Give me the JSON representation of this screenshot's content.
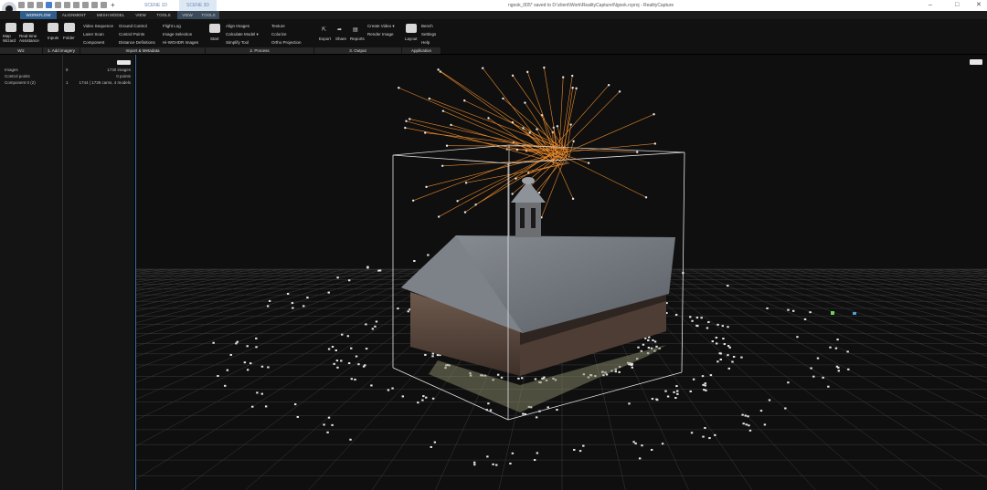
{
  "titlebar": {
    "scene_tabs": [
      "SCENE 1D",
      "SCENE 3D"
    ],
    "window_title": "ngook_005* saved to D:\\client\\Work\\RealityCapture\\Ngook.rcproj - RealityCapture",
    "minimize": "–",
    "maximize": "□",
    "close": "✕"
  },
  "tabs": [
    "WORKFLOW",
    "ALIGNMENT",
    "MESH MODEL",
    "VIEW",
    "TOOLS",
    "VIEW",
    "TOOLS"
  ],
  "ribbon": {
    "groups": [
      {
        "label": "Wiz"
      },
      {
        "label": "1. Add imagery"
      },
      {
        "label": "Import & Metadata"
      },
      {
        "label": "2. Process"
      },
      {
        "label": "3. Output"
      },
      {
        "label": "Application"
      }
    ],
    "wiz": [
      "Map Wizard",
      "Real-time Assistance"
    ],
    "add_imagery": [
      "Inputs",
      "Folder"
    ],
    "import_col1": [
      "Video Sequence",
      "Laser Scan",
      "Component"
    ],
    "import_col2": [
      "Ground Control",
      "Control Points",
      "Distance Definitions"
    ],
    "import_col3": [
      "Flight Log",
      "Image Selection",
      "Hi-WGHDR Images"
    ],
    "process_start": "Start",
    "process_col1": [
      "Align Images",
      "Calculate Model ▾",
      "Simplify Tool"
    ],
    "process_col2": [
      "Texture",
      "Colorize",
      "Ortho Projection"
    ],
    "output_btns": [
      "Export",
      "Share",
      "Reports"
    ],
    "output_col": [
      "Create Video ▾",
      "Render Image"
    ],
    "app_layout": "Layout",
    "app_col": [
      "Bench",
      "Settings",
      "Help"
    ]
  },
  "sidebar": {
    "rows": [
      {
        "label": "Images",
        "num": "8",
        "value": "1730 images"
      },
      {
        "label": "Control points",
        "num": "",
        "value": "0 points"
      },
      {
        "label": "Component 0 (2)",
        "num": "1",
        "value": "1744 | 1736 cams, 4 models"
      }
    ]
  },
  "colors": {
    "accent": "#2f5e8c",
    "camera_lines": "#e8892b",
    "bbox": "#e6e6e6",
    "grid": "#4a4a4a"
  }
}
